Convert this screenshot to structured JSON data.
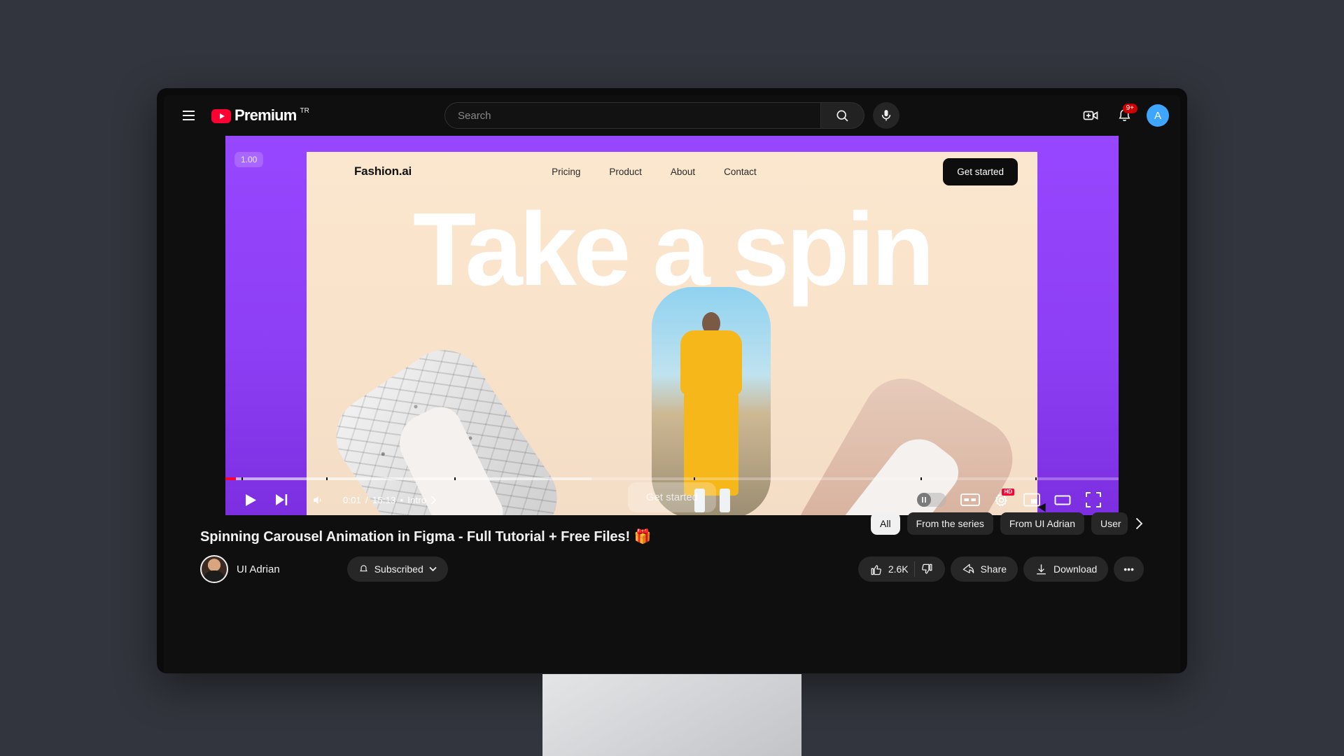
{
  "header": {
    "menu_icon": "hamburger-icon",
    "logo_word": "Premium",
    "logo_country": "TR",
    "search": {
      "value": "",
      "placeholder": "Search",
      "icon": "search-icon"
    },
    "mic_icon": "microphone-icon",
    "create_icon": "create-video-icon",
    "notifications_icon": "bell-icon",
    "notifications_count": "9+",
    "avatar_initial": "A"
  },
  "video_overlay": {
    "speed_badge": "1.00",
    "site": {
      "brand": "Fashion.ai",
      "links": [
        "Pricing",
        "Product",
        "About",
        "Contact"
      ],
      "cta": "Get started",
      "headline": "Take a spin",
      "ghost_cta": "Get started"
    }
  },
  "player": {
    "play_icon": "play-icon",
    "next_icon": "next-track-icon",
    "volume_icon": "volume-icon",
    "time_current": "0:01",
    "time_total": "15:13",
    "time_separator": "/",
    "chapter_dot": "•",
    "chapter_label": "Intro",
    "chapter_chevron": "chevron-right-icon",
    "autoplay_icon": "autoplay-toggle",
    "captions_label": "CC",
    "settings_icon": "gear-icon",
    "settings_badge": "HD",
    "miniplayer_icon": "miniplayer-icon",
    "theater_icon": "theater-mode-icon",
    "fullscreen_icon": "fullscreen-icon",
    "progress_played_pct": 1.2,
    "progress_loaded_pct": 41
  },
  "below": {
    "title": "Spinning Carousel Animation in Figma - Full Tutorial + Free Files! 🎁",
    "channel_name": "UI Adrian",
    "subscribe_label": "Subscribed",
    "subscribe_bell_icon": "bell-icon",
    "subscribe_chevron_icon": "chevron-down-icon",
    "like_count": "2.6K",
    "like_icon": "thumbs-up-icon",
    "dislike_icon": "thumbs-down-icon",
    "share_label": "Share",
    "share_icon": "share-icon",
    "download_label": "Download",
    "download_icon": "download-icon",
    "more_label": "•••"
  },
  "comment_filters": {
    "chips": [
      "All",
      "From the series",
      "From UI Adrian",
      "User"
    ],
    "active_index": 0,
    "next_icon": "chevron-right-icon"
  },
  "colors": {
    "desktop_bg": "#32353d",
    "yt_bg": "#0f0f0f",
    "brand_red": "#ff0033",
    "accent_purple": "#9747ff",
    "avatar_blue": "#3ea6ff",
    "cream": "#fbe6cf"
  }
}
